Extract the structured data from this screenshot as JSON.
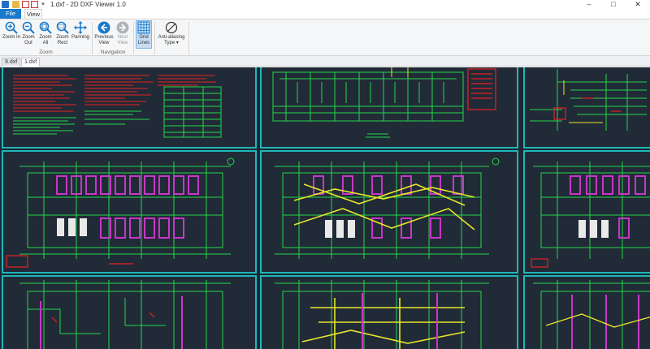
{
  "window": {
    "title": "1.dxf - 2D DXF Viewer 1.0",
    "controls": {
      "minimize": "–",
      "maximize": "□",
      "close": "✕"
    }
  },
  "quick_access": {
    "dropdown": "▾"
  },
  "ribbon_tabs": {
    "file": "File",
    "view": "View"
  },
  "ribbon": {
    "zoom_group": "Zoom",
    "navigation_group": "Navigation",
    "buttons": {
      "zoom_in": "Zoom In",
      "zoom_out": "Zoom Out",
      "zoom_all": "Zoom All",
      "zoom_rect": "Zoom Rect",
      "panning": "Panning",
      "previous_view": "Previous View",
      "next_view": "Next View",
      "grid_lines": "Grid Lines",
      "anti_aliasing": "Anti-aliasing Type ▾"
    }
  },
  "doc_tabs": [
    {
      "label": "9.dxf",
      "active": false
    },
    {
      "label": "1.dxf",
      "active": true
    }
  ],
  "colors": {
    "accent": "#1979ca",
    "canvas_bg": "#1e2733",
    "sheet_border": "#1fb7b8",
    "cad_green": "#22d84a",
    "cad_magenta": "#c837c8",
    "cad_yellow": "#e6e62a",
    "cad_red": "#e82222"
  }
}
